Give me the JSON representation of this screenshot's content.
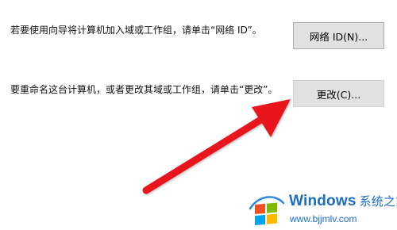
{
  "network_id": {
    "description": "若要使用向导将计算机加入域或工作组，请单击“网络 ID”。",
    "button_label": "网络 ID(N)..."
  },
  "change": {
    "description": "要重命名这台计算机，或者更改其域或工作组，请单击“更改”。",
    "button_label": "更改(C)..."
  },
  "annotation": {
    "arrow_color": "#e8191f",
    "points_to": "change-button"
  },
  "watermark": {
    "brand": "Windows",
    "brand_cn": "系统之家",
    "url": "www.bjjmlv.com",
    "color": "#1b6cc4"
  }
}
